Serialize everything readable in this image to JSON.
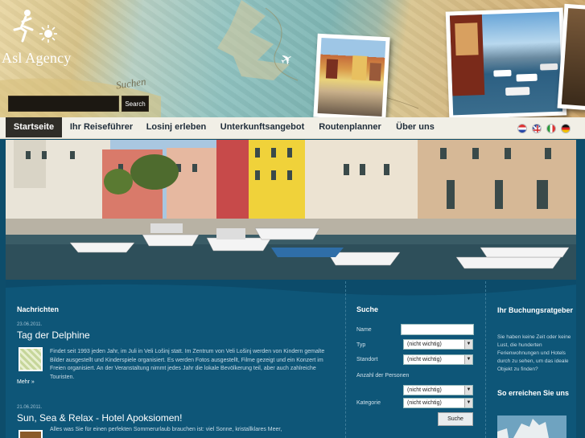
{
  "brand": {
    "name": "Asl Agency"
  },
  "header": {
    "search_placeholder": "",
    "search_button": "Search",
    "script_text": "Suchen"
  },
  "nav": {
    "items": [
      {
        "label": "Startseite"
      },
      {
        "label": "Ihr Reiseführer"
      },
      {
        "label": "Losinj erleben"
      },
      {
        "label": "Unterkunftsangebot"
      },
      {
        "label": "Routenplanner"
      },
      {
        "label": "Über uns"
      }
    ],
    "flags": [
      "croatia-flag-icon",
      "uk-flag-icon",
      "italy-flag-icon",
      "germany-flag-icon"
    ]
  },
  "news": {
    "heading": "Nachrichten",
    "items": [
      {
        "date": "23.06.2011.",
        "title": "Tag der Delphine",
        "text": "Findet seit 1993 jeden Jahr, im Juli in Veli Lošinj statt. Im Zentrum von Veli Lošinj werden von Kindern gemalte Bilder ausgestellt und Kinderspiele organisiert. Es werden Fotos ausgestellt, Filme gezeigt und ein Konzert im Freien organisiert. An der Veranstaltung nimmt jedes Jahr die lokale Bevölkerung teil, aber auch zahlreiche Touristen.",
        "more": "Mehr »"
      },
      {
        "date": "21.06.2011.",
        "title": "Sun, Sea & Relax - Hotel Apoksiomen!",
        "text": "Alles was Sie für einen perfekten Sommerurlaub brauchen ist: viel Sonne, kristallklares Meer,"
      }
    ]
  },
  "search_form": {
    "heading": "Suche",
    "fields": [
      {
        "label": "Name",
        "type": "input",
        "value": ""
      },
      {
        "label": "Typ",
        "type": "select",
        "value": "(nicht wichtig)"
      },
      {
        "label": "Standort",
        "type": "select",
        "value": "(nicht wichtig)"
      },
      {
        "label": "Anzahl der Personen",
        "type": "select",
        "value": "(nicht wichtig)"
      },
      {
        "label": "Kategorie",
        "type": "select",
        "value": "(nicht wichtig)"
      }
    ],
    "submit": "Suche"
  },
  "sidebar": {
    "advisor_heading": "Ihr Buchungsratgeber",
    "advisor_text": "Sie haben keine Zeit oder keine Lust, die hunderten Ferienwohnungen und Hotels durch zu sehen, um das ideale Objekt zu finden?",
    "reach_heading": "So erreichen Sie uns"
  },
  "colors": {
    "content_bg": "#0e5678",
    "nav_bg": "#f1efe6",
    "nav_active": "#2f2d28"
  }
}
